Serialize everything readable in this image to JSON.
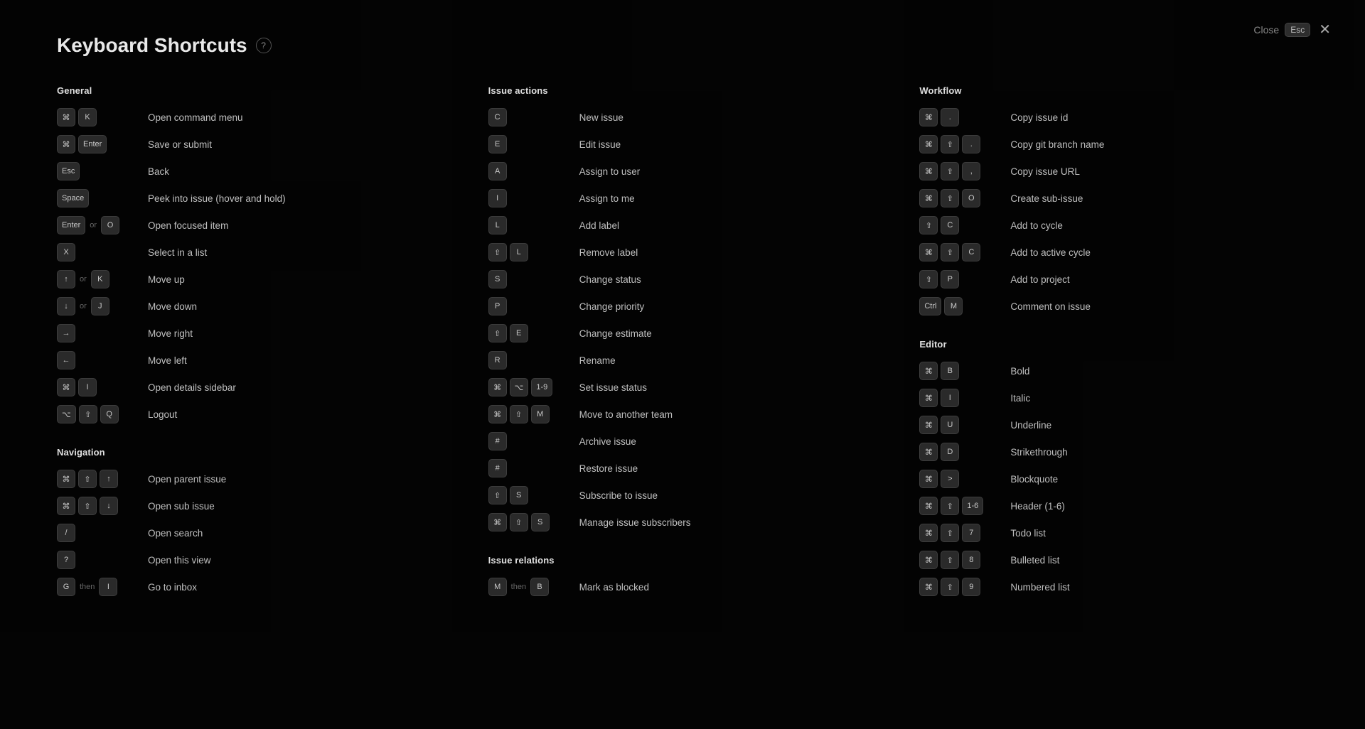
{
  "title": "Keyboard Shortcuts",
  "helpBadge": "?",
  "close": {
    "label": "Close",
    "key": "Esc"
  },
  "sections": {
    "general": {
      "title": "General",
      "shortcuts": [
        {
          "keys": [
            [
              "⌘",
              "K"
            ]
          ],
          "desc": "Open command menu"
        },
        {
          "keys": [
            [
              "⌘",
              "Enter"
            ]
          ],
          "desc": "Save or submit"
        },
        {
          "keys": [
            [
              "Esc"
            ]
          ],
          "desc": "Back"
        },
        {
          "keys": [
            [
              "Space"
            ]
          ],
          "desc": "Peek into issue (hover and hold)"
        },
        {
          "keys": [
            [
              "Enter"
            ],
            "or",
            [
              "O"
            ]
          ],
          "desc": "Open focused item"
        },
        {
          "keys": [
            [
              "X"
            ]
          ],
          "desc": "Select in a list"
        },
        {
          "keys": [
            [
              "↑"
            ],
            "or",
            [
              "K"
            ]
          ],
          "desc": "Move up"
        },
        {
          "keys": [
            [
              "↓"
            ],
            "or",
            [
              "J"
            ]
          ],
          "desc": "Move down"
        },
        {
          "keys": [
            [
              "→"
            ]
          ],
          "desc": "Move right"
        },
        {
          "keys": [
            [
              "←"
            ]
          ],
          "desc": "Move left"
        },
        {
          "keys": [
            [
              "⌘",
              "I"
            ]
          ],
          "desc": "Open details sidebar"
        },
        {
          "keys": [
            [
              "⌥",
              "⇧",
              "Q"
            ]
          ],
          "desc": "Logout"
        }
      ]
    },
    "navigation": {
      "title": "Navigation",
      "shortcuts": [
        {
          "keys": [
            [
              "⌘",
              "⇧",
              "↑"
            ]
          ],
          "desc": "Open parent issue"
        },
        {
          "keys": [
            [
              "⌘",
              "⇧",
              "↓"
            ]
          ],
          "desc": "Open sub issue"
        },
        {
          "keys": [
            [
              "/"
            ]
          ],
          "desc": "Open search"
        },
        {
          "keys": [
            [
              "?"
            ]
          ],
          "desc": "Open this view"
        },
        {
          "keys": [
            [
              "G"
            ],
            "then",
            [
              "I"
            ]
          ],
          "desc": "Go to inbox"
        }
      ]
    },
    "issue_actions": {
      "title": "Issue actions",
      "shortcuts": [
        {
          "keys": [
            [
              "C"
            ]
          ],
          "desc": "New issue"
        },
        {
          "keys": [
            [
              "E"
            ]
          ],
          "desc": "Edit issue"
        },
        {
          "keys": [
            [
              "A"
            ]
          ],
          "desc": "Assign to user"
        },
        {
          "keys": [
            [
              "I"
            ]
          ],
          "desc": "Assign to me"
        },
        {
          "keys": [
            [
              "L"
            ]
          ],
          "desc": "Add label"
        },
        {
          "keys": [
            [
              "⇧",
              "L"
            ]
          ],
          "desc": "Remove label"
        },
        {
          "keys": [
            [
              "S"
            ]
          ],
          "desc": "Change status"
        },
        {
          "keys": [
            [
              "P"
            ]
          ],
          "desc": "Change priority"
        },
        {
          "keys": [
            [
              "⇧",
              "E"
            ]
          ],
          "desc": "Change estimate"
        },
        {
          "keys": [
            [
              "R"
            ]
          ],
          "desc": "Rename"
        },
        {
          "keys": [
            [
              "⌘",
              "⌥",
              "1-9"
            ]
          ],
          "desc": "Set issue status"
        },
        {
          "keys": [
            [
              "⌘",
              "⇧",
              "M"
            ]
          ],
          "desc": "Move to another team"
        },
        {
          "keys": [
            [
              "#"
            ]
          ],
          "desc": "Archive issue"
        },
        {
          "keys": [
            [
              "#"
            ]
          ],
          "desc": "Restore issue"
        },
        {
          "keys": [
            [
              "⇧",
              "S"
            ]
          ],
          "desc": "Subscribe to issue"
        },
        {
          "keys": [
            [
              "⌘",
              "⇧",
              "S"
            ]
          ],
          "desc": "Manage issue subscribers"
        }
      ]
    },
    "issue_relations": {
      "title": "Issue relations",
      "shortcuts": [
        {
          "keys": [
            [
              "M"
            ],
            "then",
            [
              "B"
            ]
          ],
          "desc": "Mark as blocked"
        }
      ]
    },
    "workflow": {
      "title": "Workflow",
      "shortcuts": [
        {
          "keys": [
            [
              "⌘",
              "."
            ]
          ],
          "desc": "Copy issue id"
        },
        {
          "keys": [
            [
              "⌘",
              "⇧",
              "."
            ]
          ],
          "desc": "Copy git branch name"
        },
        {
          "keys": [
            [
              "⌘",
              "⇧",
              ","
            ]
          ],
          "desc": "Copy issue URL"
        },
        {
          "keys": [
            [
              "⌘",
              "⇧",
              "O"
            ]
          ],
          "desc": "Create sub-issue"
        },
        {
          "keys": [
            [
              "⇧",
              "C"
            ]
          ],
          "desc": "Add to cycle"
        },
        {
          "keys": [
            [
              "⌘",
              "⇧",
              "C"
            ]
          ],
          "desc": "Add to active cycle"
        },
        {
          "keys": [
            [
              "⇧",
              "P"
            ]
          ],
          "desc": "Add to project"
        },
        {
          "keys": [
            [
              "Ctrl",
              "M"
            ]
          ],
          "desc": "Comment on issue"
        }
      ]
    },
    "editor": {
      "title": "Editor",
      "shortcuts": [
        {
          "keys": [
            [
              "⌘",
              "B"
            ]
          ],
          "desc": "Bold"
        },
        {
          "keys": [
            [
              "⌘",
              "I"
            ]
          ],
          "desc": "Italic"
        },
        {
          "keys": [
            [
              "⌘",
              "U"
            ]
          ],
          "desc": "Underline"
        },
        {
          "keys": [
            [
              "⌘",
              "D"
            ]
          ],
          "desc": "Strikethrough"
        },
        {
          "keys": [
            [
              "⌘",
              ">"
            ]
          ],
          "desc": "Blockquote"
        },
        {
          "keys": [
            [
              "⌘",
              "⇧",
              "1-6"
            ]
          ],
          "desc": "Header (1-6)"
        },
        {
          "keys": [
            [
              "⌘",
              "⇧",
              "7"
            ]
          ],
          "desc": "Todo list"
        },
        {
          "keys": [
            [
              "⌘",
              "⇧",
              "8"
            ]
          ],
          "desc": "Bulleted list"
        },
        {
          "keys": [
            [
              "⌘",
              "⇧",
              "9"
            ]
          ],
          "desc": "Numbered list"
        }
      ]
    }
  }
}
